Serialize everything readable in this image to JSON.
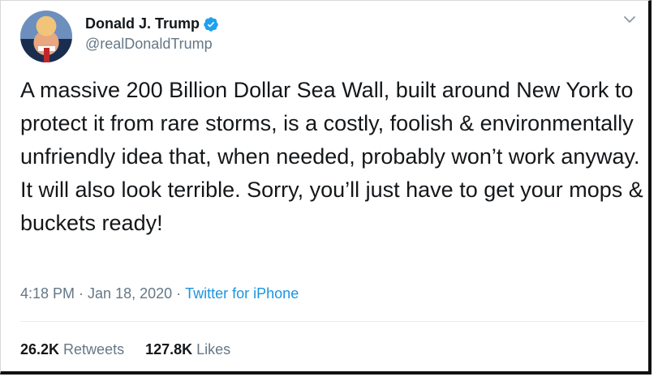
{
  "author": {
    "display_name": "Donald J. Trump",
    "handle": "@realDonaldTrump",
    "verified": true
  },
  "tweet": {
    "text": "A massive 200 Billion Dollar Sea Wall, built around New York to protect it from rare storms, is a costly, foolish & environmentally unfriendly idea that, when needed, probably won’t work anyway. It will also look terrible. Sorry, you’ll just have to get your mops & buckets ready!",
    "time": "4:18 PM",
    "date": "Jan 18, 2020",
    "separator": "·",
    "source": "Twitter for iPhone"
  },
  "stats": {
    "retweets_count": "26.2K",
    "retweets_label": "Retweets",
    "likes_count": "127.8K",
    "likes_label": "Likes"
  },
  "colors": {
    "accent": "#1da1f2",
    "secondary_text": "#657786",
    "primary_text": "#14171a"
  },
  "icons": [
    "verified-badge-icon",
    "chevron-down-icon"
  ]
}
